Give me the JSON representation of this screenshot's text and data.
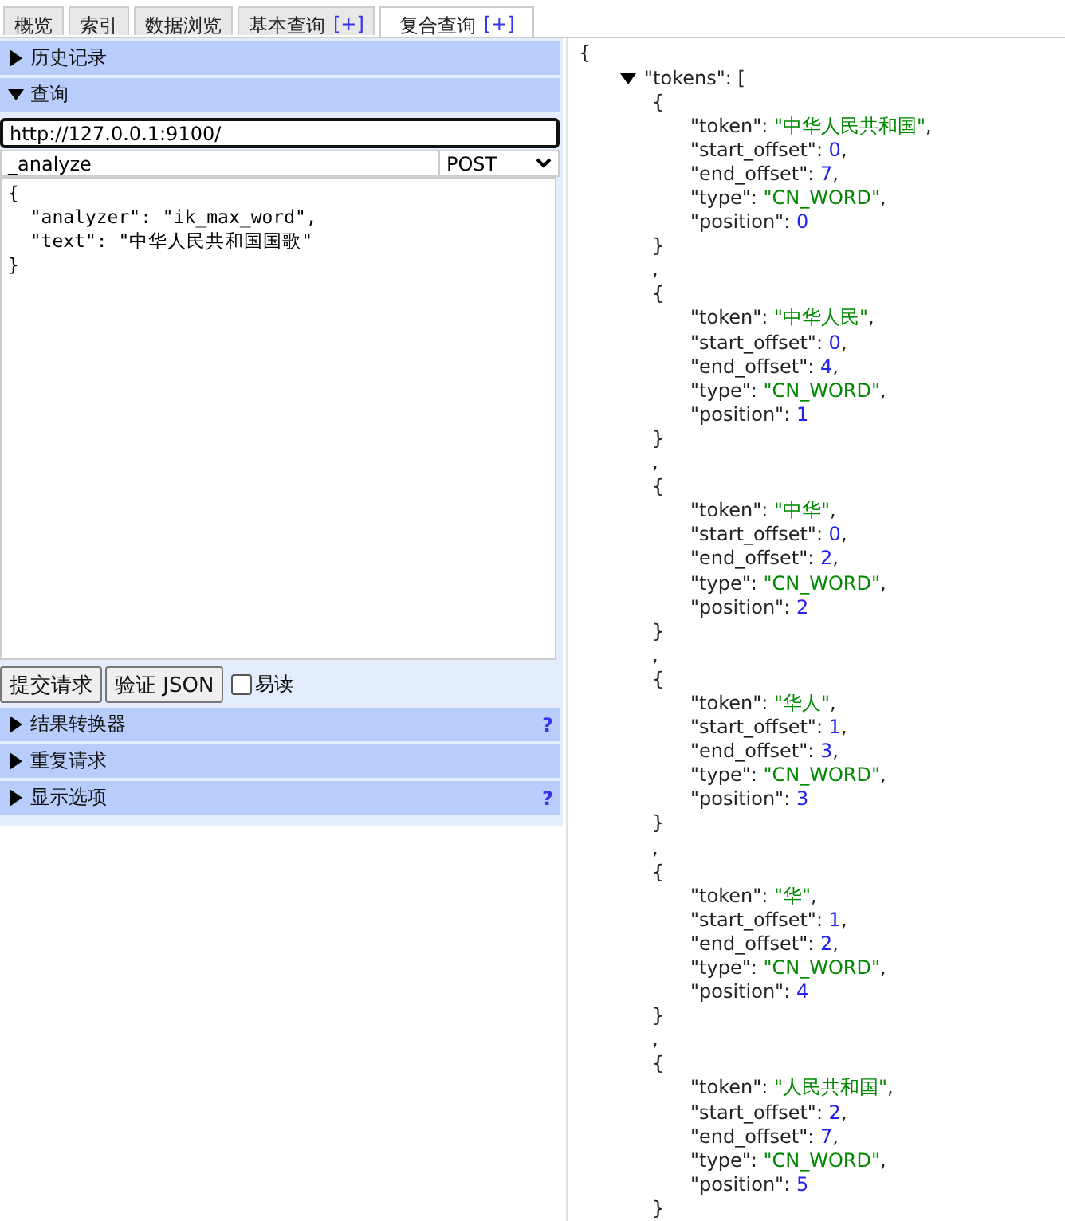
{
  "tabs": [
    {
      "label": "概览",
      "selected": false
    },
    {
      "label": "索引",
      "selected": false
    },
    {
      "label": "数据浏览",
      "selected": false
    },
    {
      "label": "基本查询",
      "plus": "[+]",
      "selected": false
    },
    {
      "label": "复合查询",
      "plus": "[+]",
      "selected": true
    }
  ],
  "history": {
    "label": "历史记录",
    "expanded": false
  },
  "query": {
    "label": "查询",
    "expanded": true,
    "url": "http://127.0.0.1:9100/",
    "path": "_analyze",
    "method": "POST",
    "body": "{\n  \"analyzer\": \"ik_max_word\",\n  \"text\": \"中华人民共和国国歌\"\n}",
    "buttons": [
      "提交请求",
      "验证 JSON"
    ],
    "readable": {
      "label": "易读",
      "checked": false
    }
  },
  "extra_sections": [
    {
      "label": "结果转换器",
      "expanded": false,
      "help": "?"
    },
    {
      "label": "重复请求",
      "expanded": false
    },
    {
      "label": "显示选项",
      "expanded": false,
      "help": "?"
    }
  ],
  "response": {
    "syntax": {
      "open_object": "{",
      "close_object": "}",
      "open_array": "[",
      "quote": "\"",
      "colon": ": ",
      "comma": ","
    },
    "key": "tokens",
    "expanded": true,
    "items": [
      [
        {
          "key": "token",
          "value": "中华人民共和国",
          "kind": "string"
        },
        {
          "key": "start_offset",
          "value": "0",
          "kind": "number"
        },
        {
          "key": "end_offset",
          "value": "7",
          "kind": "number"
        },
        {
          "key": "type",
          "value": "CN_WORD",
          "kind": "string"
        },
        {
          "key": "position",
          "value": "0",
          "kind": "number"
        }
      ],
      [
        {
          "key": "token",
          "value": "中华人民",
          "kind": "string"
        },
        {
          "key": "start_offset",
          "value": "0",
          "kind": "number"
        },
        {
          "key": "end_offset",
          "value": "4",
          "kind": "number"
        },
        {
          "key": "type",
          "value": "CN_WORD",
          "kind": "string"
        },
        {
          "key": "position",
          "value": "1",
          "kind": "number"
        }
      ],
      [
        {
          "key": "token",
          "value": "中华",
          "kind": "string"
        },
        {
          "key": "start_offset",
          "value": "0",
          "kind": "number"
        },
        {
          "key": "end_offset",
          "value": "2",
          "kind": "number"
        },
        {
          "key": "type",
          "value": "CN_WORD",
          "kind": "string"
        },
        {
          "key": "position",
          "value": "2",
          "kind": "number"
        }
      ],
      [
        {
          "key": "token",
          "value": "华人",
          "kind": "string"
        },
        {
          "key": "start_offset",
          "value": "1",
          "kind": "number"
        },
        {
          "key": "end_offset",
          "value": "3",
          "kind": "number"
        },
        {
          "key": "type",
          "value": "CN_WORD",
          "kind": "string"
        },
        {
          "key": "position",
          "value": "3",
          "kind": "number"
        }
      ],
      [
        {
          "key": "token",
          "value": "华",
          "kind": "string"
        },
        {
          "key": "start_offset",
          "value": "1",
          "kind": "number"
        },
        {
          "key": "end_offset",
          "value": "2",
          "kind": "number"
        },
        {
          "key": "type",
          "value": "CN_WORD",
          "kind": "string"
        },
        {
          "key": "position",
          "value": "4",
          "kind": "number"
        }
      ],
      [
        {
          "key": "token",
          "value": "人民共和国",
          "kind": "string"
        },
        {
          "key": "start_offset",
          "value": "2",
          "kind": "number"
        },
        {
          "key": "end_offset",
          "value": "7",
          "kind": "number"
        },
        {
          "key": "type",
          "value": "CN_WORD",
          "kind": "string"
        },
        {
          "key": "position",
          "value": "5",
          "kind": "number"
        }
      ]
    ]
  }
}
